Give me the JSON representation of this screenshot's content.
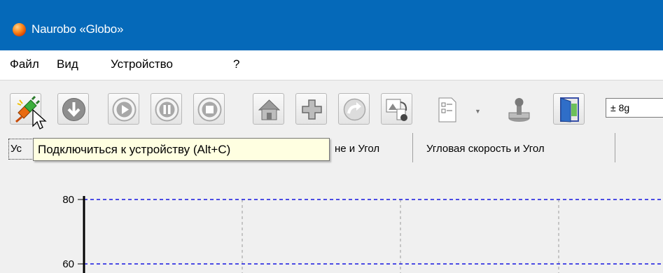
{
  "window": {
    "title": "Naurobo «Globo»"
  },
  "menu": {
    "items": [
      "Файл",
      "Вид",
      "Устройство",
      "?"
    ]
  },
  "toolbar": {
    "buttons": [
      "connect-button",
      "disconnect-button",
      "play-button",
      "pause-button",
      "stop-button",
      "home-button",
      "add-button",
      "redo-button",
      "import-button",
      "export-button",
      "joystick-button",
      "exit-button"
    ],
    "range_select": {
      "value": "± 8g"
    }
  },
  "tabs": {
    "items": [
      {
        "label": "Ус"
      },
      {
        "label": "не и Угол"
      },
      {
        "label": "Угловая скорость и Угол"
      }
    ]
  },
  "tooltip": {
    "text": "Подключиться к устройству (Alt+C)"
  },
  "chart_data": {
    "type": "line",
    "yticks": [
      "80",
      "60"
    ],
    "grid": true,
    "reference_lines_y": [
      80,
      60
    ],
    "reference_line_color": "#0000ff"
  }
}
